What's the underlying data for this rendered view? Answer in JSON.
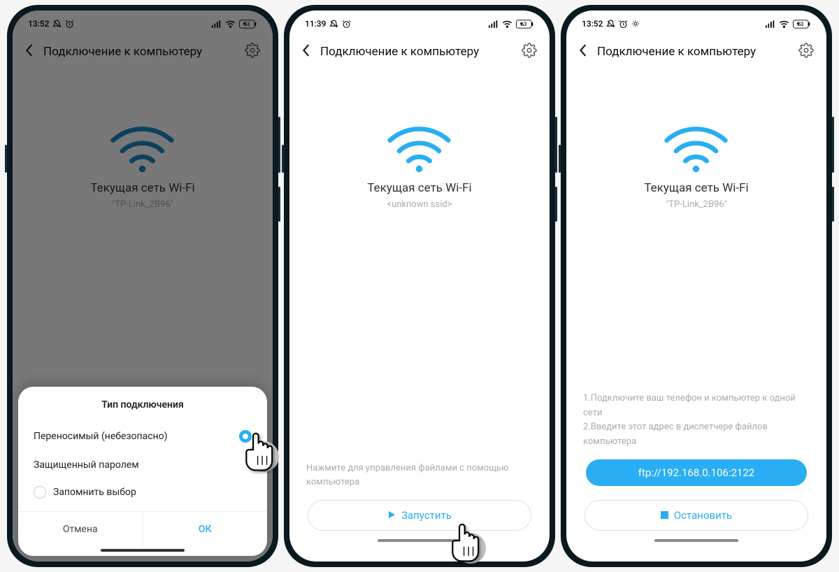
{
  "screens": [
    {
      "statusbar": {
        "time": "13:52",
        "battery": "53"
      },
      "appbar": {
        "title": "Подключение к компьютеру"
      },
      "wifi": {
        "label": "Текущая сеть Wi-Fi",
        "ssid": "\"TP-Link_2B96\""
      },
      "dialog": {
        "title": "Тип подключения",
        "option1": "Переносимый (небезопасно)",
        "option2": "Защищенный паролем",
        "remember": "Запомнить выбор",
        "cancel": "Отмена",
        "ok": "ОК"
      }
    },
    {
      "statusbar": {
        "time": "11:39",
        "battery": "63"
      },
      "appbar": {
        "title": "Подключение к компьютеру"
      },
      "wifi": {
        "label": "Текущая сеть Wi-Fi",
        "ssid": "<unknown ssid>"
      },
      "hint": "Нажмите для управления файлами с помощью компьютера",
      "action": "Запустить"
    },
    {
      "statusbar": {
        "time": "13:52",
        "battery": "53"
      },
      "appbar": {
        "title": "Подключение к компьютеру"
      },
      "wifi": {
        "label": "Текущая сеть Wi-Fi",
        "ssid": "\"TP-Link_2B96\""
      },
      "instructions": {
        "line1": "1.Подключите ваш телефон и компьютер к одной сети",
        "line2": "2.Введите этот адрес в диспетчере файлов компьютера"
      },
      "ftp": "ftp://192.168.0.106:2122",
      "action": "Остановить"
    }
  ],
  "colors": {
    "accent": "#29aef3"
  }
}
